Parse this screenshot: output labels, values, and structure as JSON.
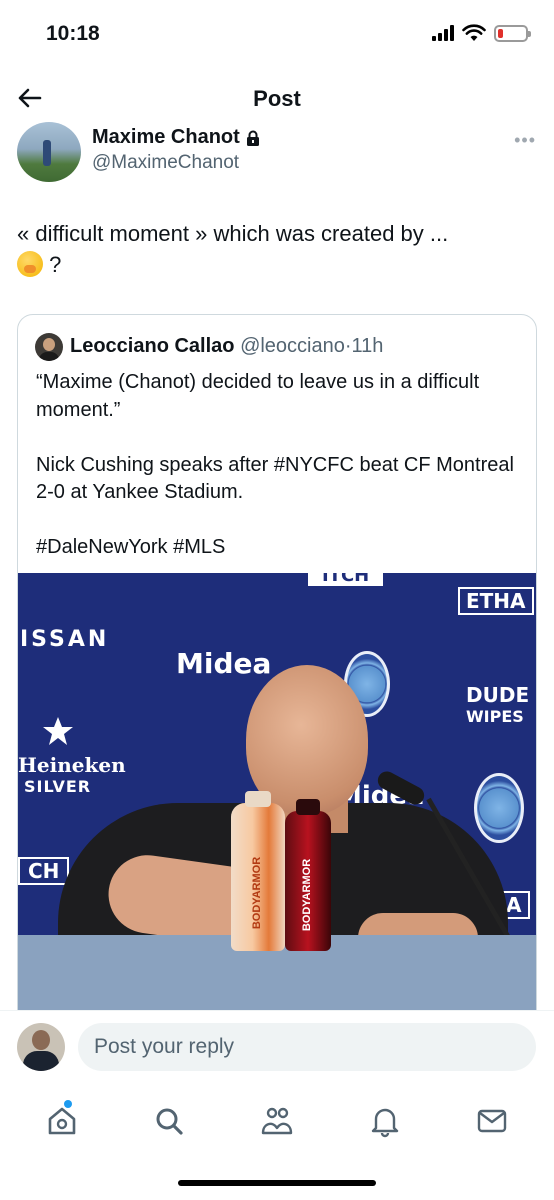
{
  "status_bar": {
    "time": "10:18",
    "battery_level": 0.2,
    "battery_color": "#e0302b",
    "icons": [
      "cellular-signal-icon",
      "wifi-icon",
      "battery-icon"
    ]
  },
  "header": {
    "title": "Post",
    "back_icon": "arrow-left-icon"
  },
  "post": {
    "author_name": "Maxime Chanot",
    "author_handle": "@MaximeChanot",
    "protected": true,
    "text": "« difficult moment » which was created by ...",
    "text_line2": "?",
    "emoji": "face-with-hand-over-mouth",
    "more_icon": "ellipsis-icon"
  },
  "quoted_post": {
    "author_name": "Leocciano Callao",
    "author_handle": "@leocciano",
    "separator": "·",
    "time_ago": "11h",
    "body": "“Maxime (Chanot) decided to leave us in a difficult moment.”\n\nNick Cushing speaks after #NYCFC beat CF Montreal 2-0 at Yankee Stadium.\n\n#DaleNewYork #MLS",
    "photo": {
      "backdrop_texts": [
        "ITCH",
        "ISSAN",
        "Midea",
        "Heineken",
        "SILVER",
        "DUDE",
        "WIPES",
        "Midea",
        "CH",
        "ETHA",
        "ETHA"
      ],
      "bottle_labels": [
        "BODYARMOR",
        "BODYARMOR"
      ]
    }
  },
  "reply": {
    "placeholder": "Post your reply"
  },
  "bottom_nav": {
    "items": [
      "home-icon",
      "search-icon",
      "communities-icon",
      "notifications-icon",
      "messages-icon"
    ],
    "accent_color": "#1d9bf0"
  }
}
